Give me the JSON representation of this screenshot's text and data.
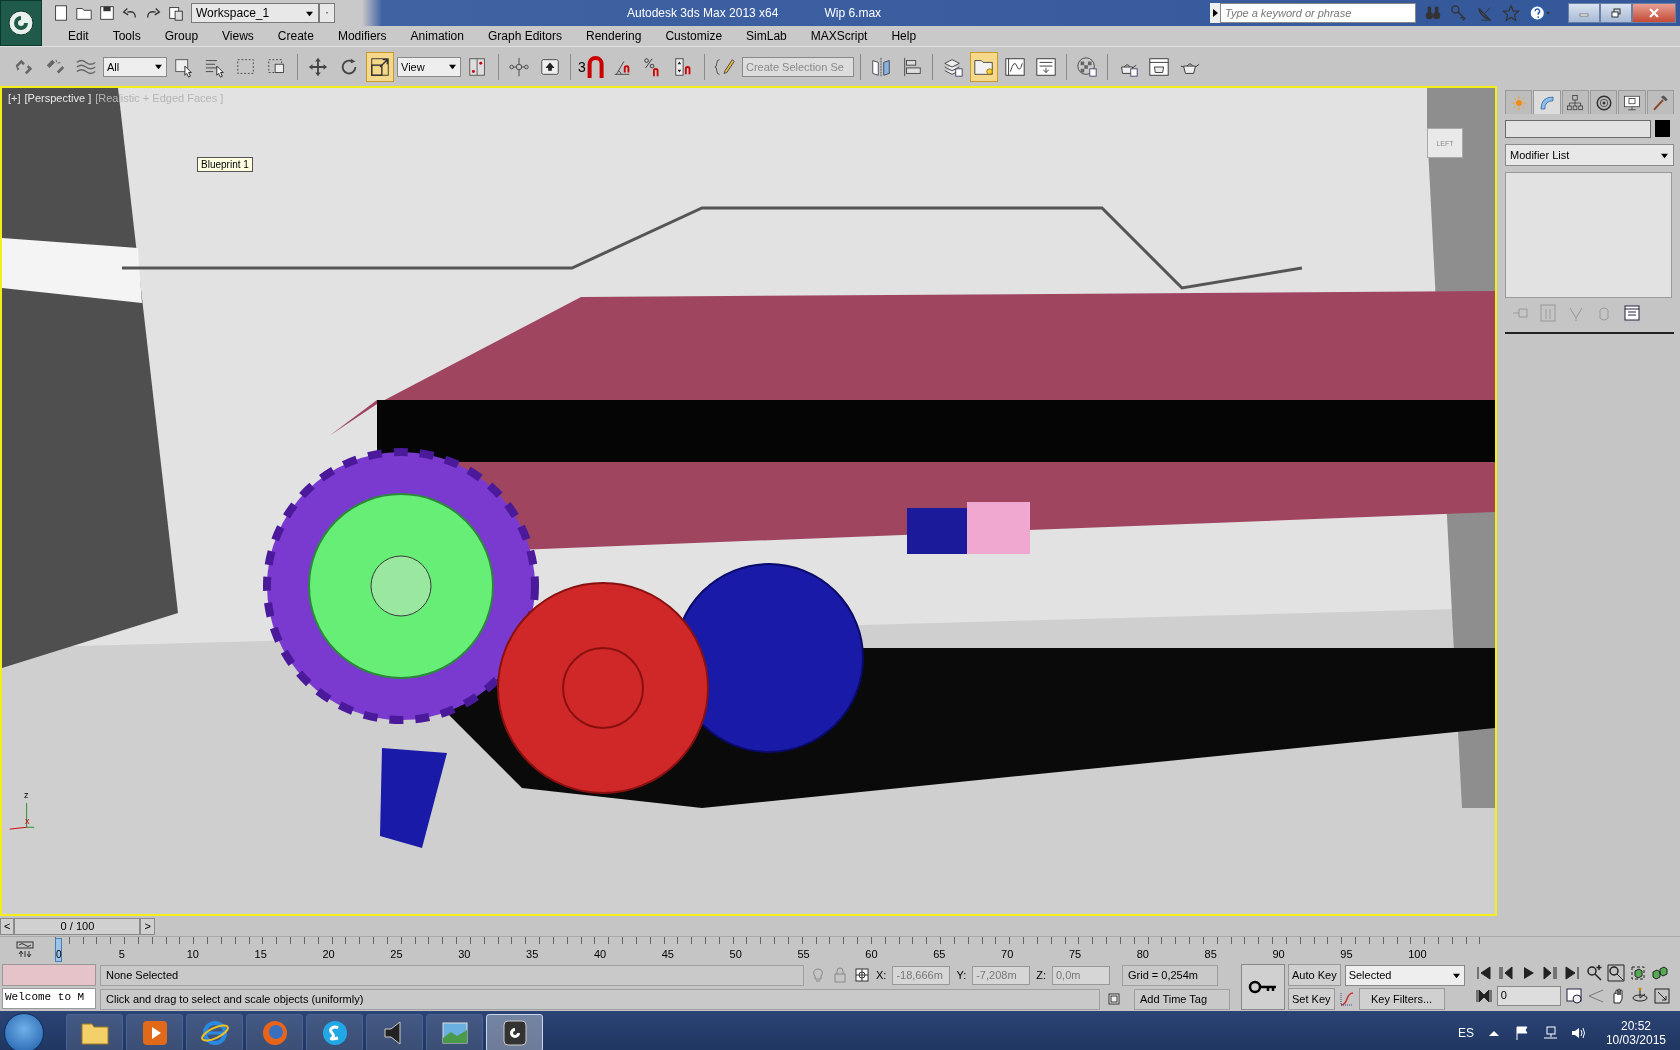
{
  "title_bar": {
    "workspace": "Workspace_1",
    "app_title": "Autodesk 3ds Max  2013 x64",
    "file_name": "Wip 6.max",
    "search": {
      "placeholder": "Type a keyword or phrase"
    }
  },
  "menu": [
    "Edit",
    "Tools",
    "Group",
    "Views",
    "Create",
    "Modifiers",
    "Animation",
    "Graph Editors",
    "Rendering",
    "Customize",
    "SimLab",
    "MAXScript",
    "Help"
  ],
  "toolbar": [
    {
      "kind": "link",
      "selected": false
    },
    {
      "kind": "unlink",
      "selected": false
    },
    {
      "kind": "bind",
      "selected": false
    },
    {
      "kind": "dropdown",
      "value": "All"
    },
    {
      "kind": "select",
      "selected": false
    },
    {
      "kind": "selectname",
      "selected": false
    },
    {
      "kind": "region",
      "selected": false
    },
    {
      "kind": "crossing",
      "selected": false
    },
    {
      "kind": "separator"
    },
    {
      "kind": "move",
      "selected": false
    },
    {
      "kind": "rotate",
      "selected": false
    },
    {
      "kind": "scale",
      "selected": true
    },
    {
      "kind": "dropdown",
      "value": "View"
    },
    {
      "kind": "pivot",
      "selected": false
    },
    {
      "kind": "separator"
    },
    {
      "kind": "manipulate",
      "selected": false
    },
    {
      "kind": "keyboard",
      "selected": false
    },
    {
      "kind": "separator"
    },
    {
      "kind": "snap",
      "label": "3",
      "selected": false
    },
    {
      "kind": "anglesnap",
      "selected": false
    },
    {
      "kind": "percentsnap",
      "selected": false
    },
    {
      "kind": "spinnersnap",
      "selected": false
    },
    {
      "kind": "separator"
    },
    {
      "kind": "namedsel",
      "selected": false
    },
    {
      "kind": "field",
      "placeholder": "Create Selection Se"
    },
    {
      "kind": "separator"
    },
    {
      "kind": "mirror",
      "selected": false
    },
    {
      "kind": "align",
      "selected": false
    },
    {
      "kind": "separator"
    },
    {
      "kind": "layers",
      "selected": false
    },
    {
      "kind": "explorer",
      "selected": true
    },
    {
      "kind": "curves",
      "selected": false
    },
    {
      "kind": "schematic",
      "selected": false
    },
    {
      "kind": "separator"
    },
    {
      "kind": "material",
      "selected": false
    },
    {
      "kind": "separator"
    },
    {
      "kind": "rendersetup",
      "selected": false
    },
    {
      "kind": "frame",
      "selected": false
    },
    {
      "kind": "render",
      "selected": false
    }
  ],
  "viewport": {
    "labels": [
      "[+]",
      "[Perspective ]",
      "[Realistic + Edged Faces ]"
    ],
    "tooltip": "Blueprint 1",
    "viewcube_label": "LEFT",
    "axis_labels": [
      "z",
      "x"
    ]
  },
  "command_panel": {
    "tabs": [
      {
        "kind": "create",
        "selected": false
      },
      {
        "kind": "modify",
        "selected": true
      },
      {
        "kind": "hierarchy",
        "selected": false
      },
      {
        "kind": "motion",
        "selected": false
      },
      {
        "kind": "display",
        "selected": false
      },
      {
        "kind": "utilities",
        "selected": false
      }
    ],
    "modifier_list": "Modifier List"
  },
  "time_slider": {
    "prev": "<",
    "position": "0 / 100",
    "next": ">"
  },
  "track_bar": {
    "ticks": [
      "0",
      "5",
      "10",
      "15",
      "20",
      "25",
      "30",
      "35",
      "40",
      "45",
      "50",
      "55",
      "60",
      "65",
      "70",
      "75",
      "80",
      "85",
      "90",
      "95",
      "100"
    ]
  },
  "status": {
    "listener": "Welcome to M",
    "selection": "None Selected",
    "prompt": "Click and drag to select and scale objects (uniformly)",
    "x_label": "X:",
    "x": "-18,666m",
    "y_label": "Y:",
    "y": "-7,208m",
    "z_label": "Z:",
    "z": "0,0m",
    "grid": "Grid = 0,254m",
    "time_tag": "Add Time Tag",
    "auto_key": "Auto Key",
    "set_key": "Set Key",
    "key_mode": "Selected",
    "key_filters": "Key Filters...",
    "frame": "0"
  },
  "taskbar": {
    "apps": [
      {
        "kind": "folder",
        "selected": false
      },
      {
        "kind": "media",
        "selected": false
      },
      {
        "kind": "browser",
        "selected": false
      },
      {
        "kind": "firefox",
        "selected": false
      },
      {
        "kind": "chat",
        "selected": false
      },
      {
        "kind": "speaker",
        "selected": false
      },
      {
        "kind": "photos",
        "selected": false
      },
      {
        "kind": "max",
        "selected": true
      }
    ],
    "language": "ES",
    "time": "20:52",
    "date": "10/03/2015"
  }
}
